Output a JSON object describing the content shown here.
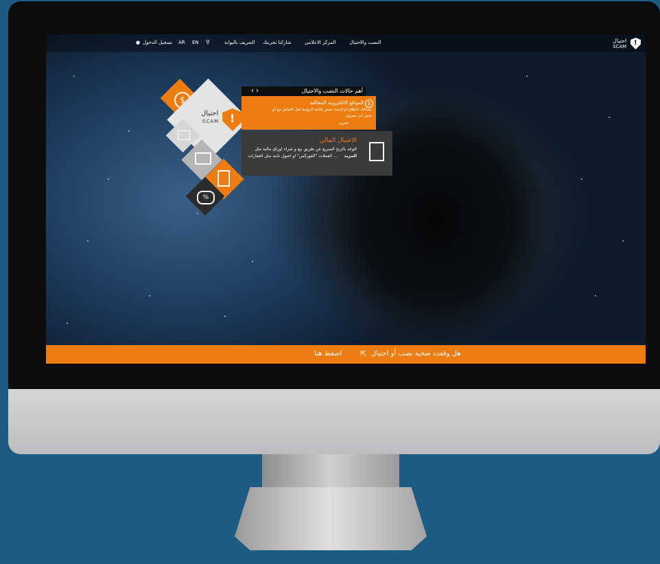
{
  "nav": {
    "logo_ar": "احتيال",
    "logo_en": "SCAM",
    "items": [
      "النصب والاحتيال",
      "المركز الاعلامي",
      "شاركنا تجربتك",
      "التعريف بالبوابة"
    ],
    "search_icon": "search-icon",
    "lang_en": "EN",
    "lang_ar": "AR",
    "login": "تسجيل الدخول",
    "user_icon": "user-icon"
  },
  "cases": {
    "header": "أهم حالات النصب والاحتيال",
    "orange_title": "المواقع الالكترونية المخالفة",
    "orange_body_1": "بإمكانك الاطلاع أو البحث ضمن قائمة الروابط قبل التعامل مع أي",
    "orange_body_2": "متجر غير معروف",
    "orange_more": "المزيد",
    "dark_title": "الاحتيال المالي",
    "dark_body_1": "الوعد بالربح السريع عن طريق بيع و شراء اوراق مالية مثل",
    "dark_body_2": "العملات \"الفوركس\" او اصول ثابته مثل العقارات ...",
    "dark_more": "المزيد"
  },
  "tiles": {
    "logo_ar": "احتيال",
    "logo_en": "SCAM"
  },
  "bottom": {
    "text_left": "هل وقعت ضحية نصب أو احتيال",
    "text_right": "اضغط هنا",
    "cursor_icon": "cursor-icon"
  },
  "colors": {
    "accent": "#ee7d11",
    "dark": "#3a3b3d",
    "background": "#1d5b82"
  }
}
